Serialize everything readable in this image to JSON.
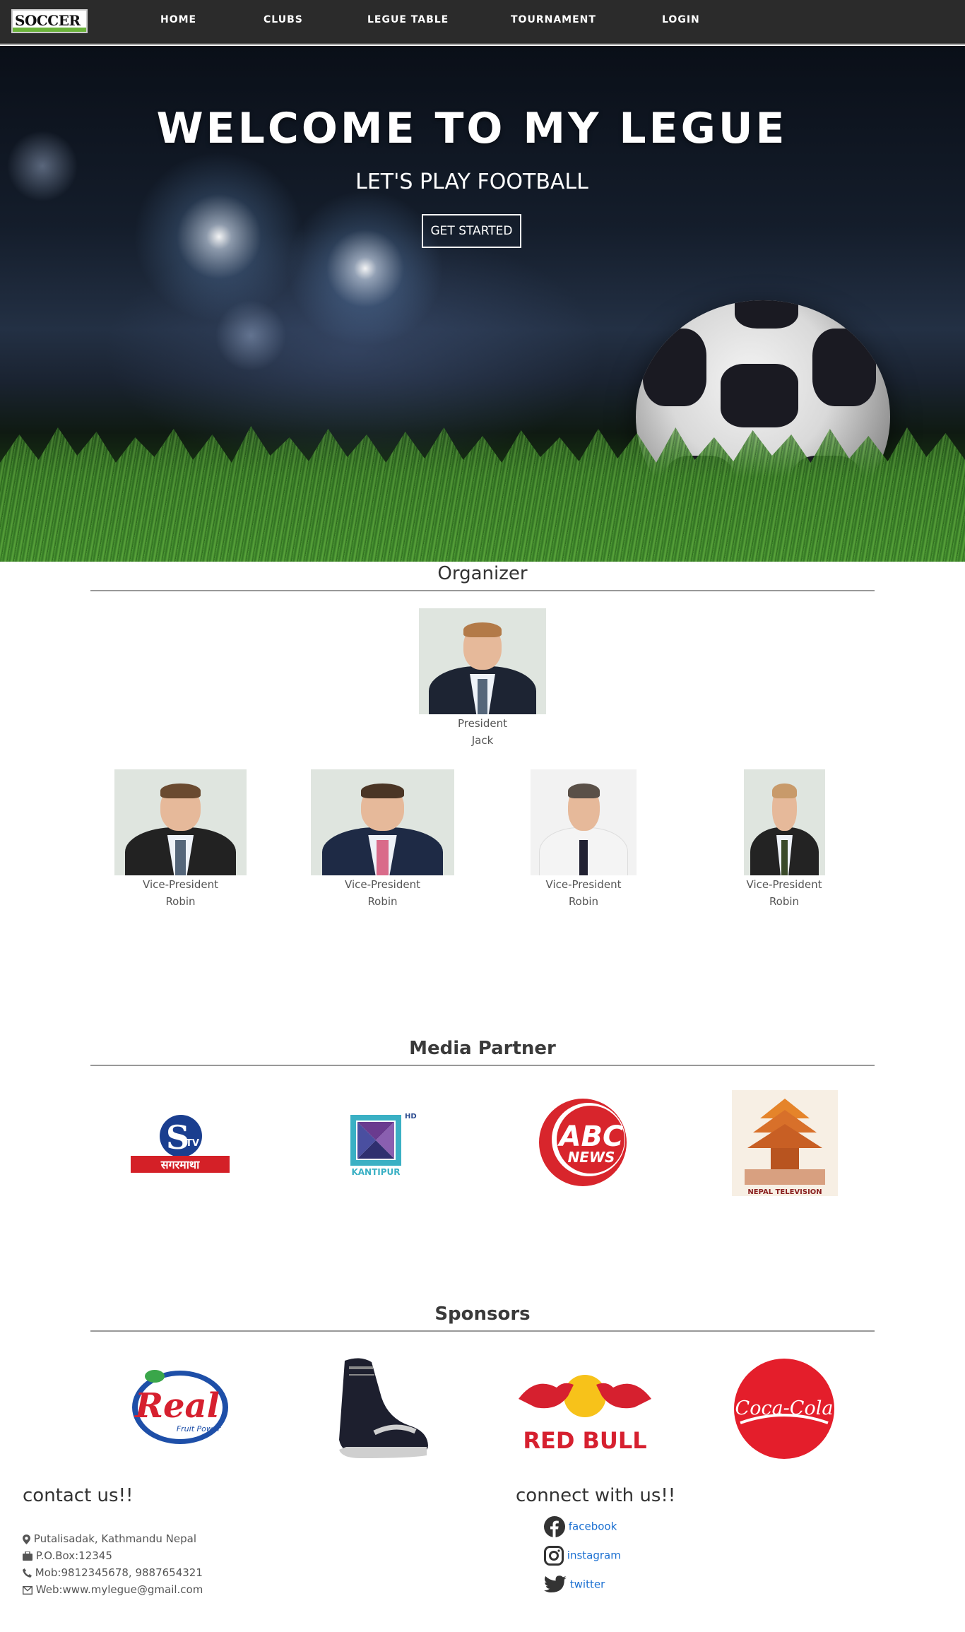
{
  "nav": {
    "logo_text": "SOCCER",
    "links": [
      "HOME",
      "CLUBS",
      "LEGUE TABLE",
      "TOURNAMENT",
      "LOGIN"
    ]
  },
  "hero": {
    "title": "WELCOME TO MY LEGUE",
    "subtitle": "LET'S PLAY FOOTBALL",
    "button": "GET STARTED"
  },
  "organizer": {
    "title": "Organizer",
    "president": {
      "role": "President",
      "name": "Jack"
    },
    "vice_presidents": [
      {
        "role": "Vice-President",
        "name": "Robin"
      },
      {
        "role": "Vice-President",
        "name": "Robin"
      },
      {
        "role": "Vice-President",
        "name": "Robin"
      },
      {
        "role": "Vice-President",
        "name": "Robin"
      }
    ]
  },
  "media": {
    "title": "Media Partner",
    "logos": [
      "sagarmatha-tv-logo",
      "kantipur-hd-logo",
      "abc-news-logo",
      "nepal-television-logo"
    ],
    "labels": {
      "sagarmatha": "सगरमाथा",
      "kantipur": "KANTIPUR",
      "kantipur_hd": "HD",
      "abc1": "ABC",
      "abc2": "NEWS",
      "ntv": "NEPAL TELEVISION"
    }
  },
  "sponsors": {
    "title": "Sponsors",
    "labels": {
      "real": "Real",
      "real_sub": "Fruit Power",
      "redbull": "RED BULL",
      "coke": "Coca-Cola"
    }
  },
  "contact": {
    "title": "contact us!!",
    "address": "Putalisadak, Kathmandu Nepal",
    "pobox": "P.O.Box:12345",
    "mobile": "Mob:9812345678, 9887654321",
    "web": "Web:www.mylegue@gmail.com"
  },
  "connect": {
    "title": "connect with us!!",
    "facebook": "facebook",
    "instagram": "instagram",
    "twitter": "twitter"
  },
  "colors": {
    "nav_bg": "#2b2b2b",
    "link_blue": "#1a6fd1",
    "redbull_red": "#d6202f",
    "coke_red": "#e41e2b"
  }
}
